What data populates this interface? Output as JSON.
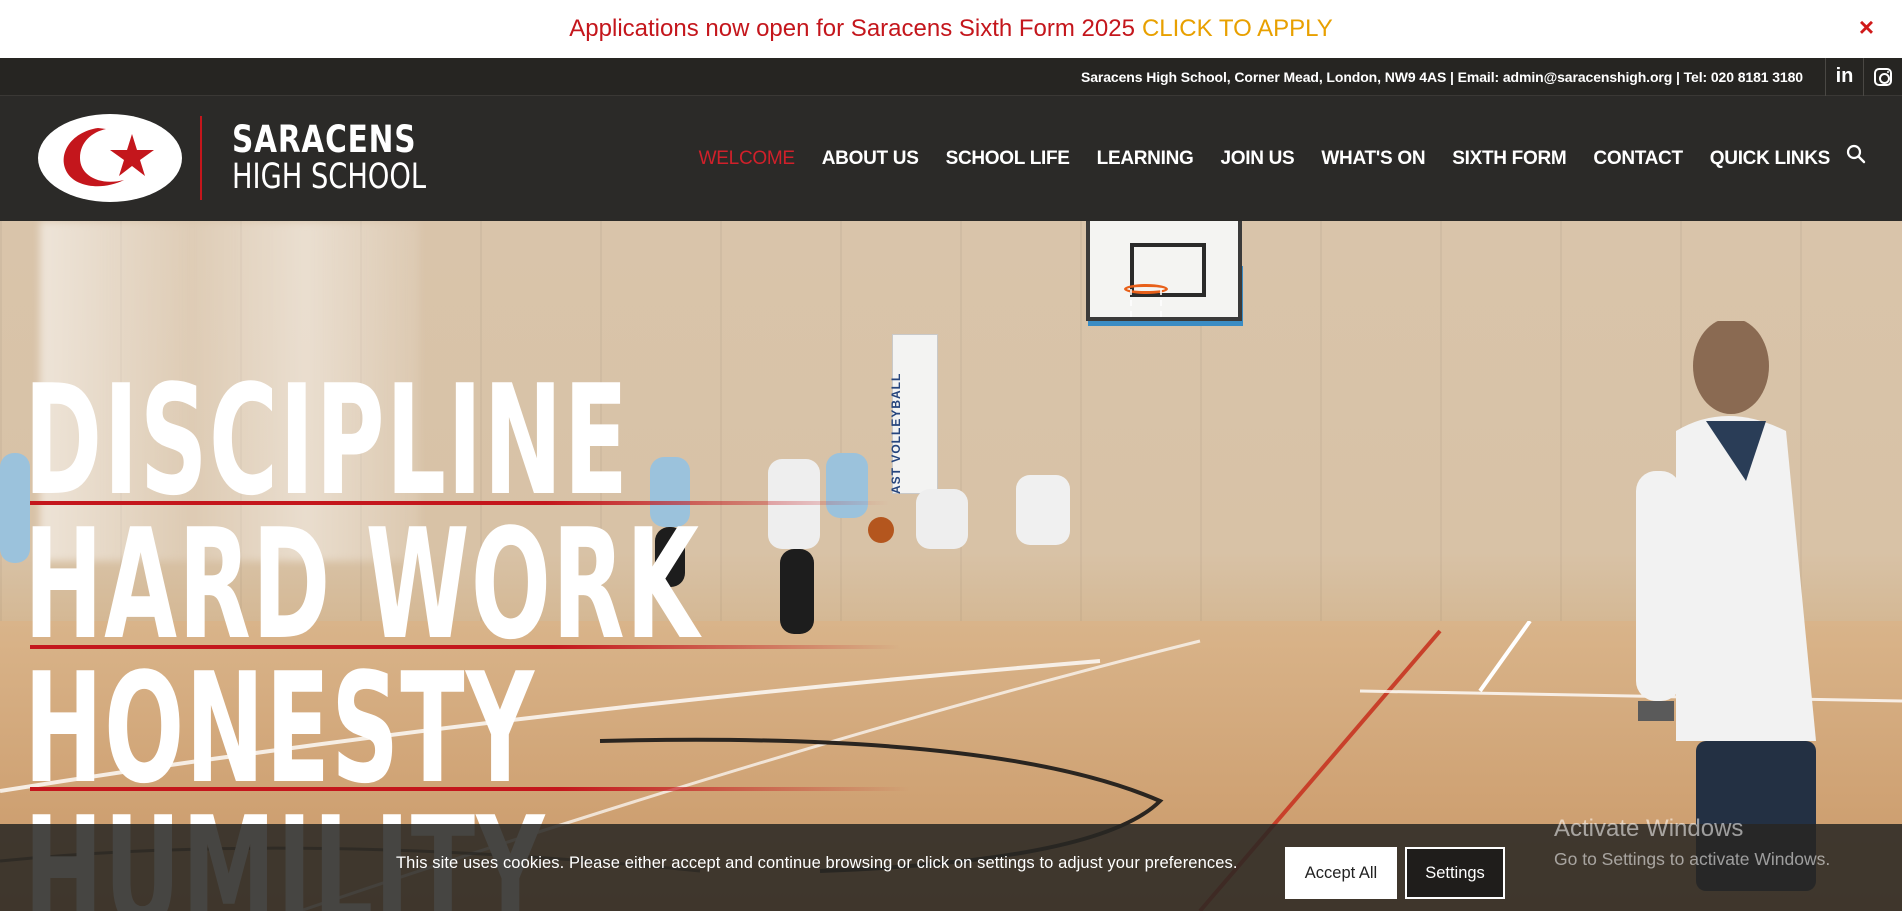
{
  "announcement": {
    "text": "Applications now open for Saracens Sixth Form 2025",
    "cta": "CLICK TO APPLY",
    "close": "×"
  },
  "infobar": {
    "address": "Saracens High School, Corner Mead, London, NW9 4AS | Email: admin@saracenshigh.org | Tel: 020 8181 3180",
    "linkedin": "in"
  },
  "logo": {
    "line1": "SARACENS",
    "line2": "HIGH SCHOOL"
  },
  "nav": {
    "items": [
      {
        "label": "WELCOME",
        "active": true
      },
      {
        "label": "ABOUT US"
      },
      {
        "label": "SCHOOL LIFE"
      },
      {
        "label": "LEARNING"
      },
      {
        "label": "JOIN US"
      },
      {
        "label": "WHAT'S ON"
      },
      {
        "label": "SIXTH FORM"
      },
      {
        "label": "CONTACT"
      },
      {
        "label": "QUICK LINKS"
      }
    ]
  },
  "hero": {
    "words": [
      "DISCIPLINE",
      "HARD WORK",
      "HONESTY",
      "HUMILITY"
    ],
    "banner": "AST VOLLEYBALL"
  },
  "cookie": {
    "message": "This site uses cookies. Please either accept and continue browsing or click on settings to adjust your preferences.",
    "accept": "Accept All",
    "settings": "Settings"
  },
  "watermark": {
    "title": "Activate Windows",
    "subtitle": "Go to Settings to activate Windows."
  },
  "colors": {
    "brand_red": "#c4161c",
    "cta_gold": "#e8a000",
    "header_bg": "#2b2a28"
  }
}
